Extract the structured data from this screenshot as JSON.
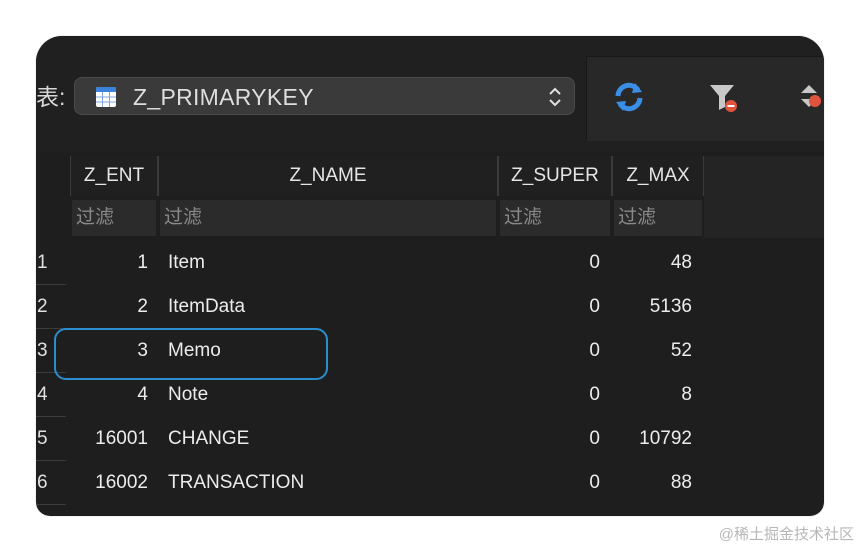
{
  "toolbar": {
    "table_label": "表:",
    "table_select": "Z_PRIMARYKEY",
    "icons": [
      "refresh-icon",
      "filter-clear-icon",
      "sort-icon"
    ]
  },
  "columns": [
    {
      "key": "z_ent",
      "label": "Z_ENT",
      "filter_placeholder": "过滤"
    },
    {
      "key": "z_name",
      "label": "Z_NAME",
      "filter_placeholder": "过滤"
    },
    {
      "key": "z_super",
      "label": "Z_SUPER",
      "filter_placeholder": "过滤"
    },
    {
      "key": "z_max",
      "label": "Z_MAX",
      "filter_placeholder": "过滤"
    }
  ],
  "rows": [
    {
      "index": "1",
      "z_ent": "1",
      "z_name": "Item",
      "z_super": "0",
      "z_max": "48"
    },
    {
      "index": "2",
      "z_ent": "2",
      "z_name": "ItemData",
      "z_super": "0",
      "z_max": "5136"
    },
    {
      "index": "3",
      "z_ent": "3",
      "z_name": "Memo",
      "z_super": "0",
      "z_max": "52"
    },
    {
      "index": "4",
      "z_ent": "4",
      "z_name": "Note",
      "z_super": "0",
      "z_max": "8"
    },
    {
      "index": "5",
      "z_ent": "16001",
      "z_name": "CHANGE",
      "z_super": "0",
      "z_max": "10792"
    },
    {
      "index": "6",
      "z_ent": "16002",
      "z_name": "TRANSACTION",
      "z_super": "0",
      "z_max": "88"
    }
  ],
  "colors": {
    "accent_highlight": "#2b8ecf",
    "refresh_icon": "#3a8ee6",
    "filter_badge": "#e0533c"
  },
  "watermark": "@稀土掘金技术社区"
}
